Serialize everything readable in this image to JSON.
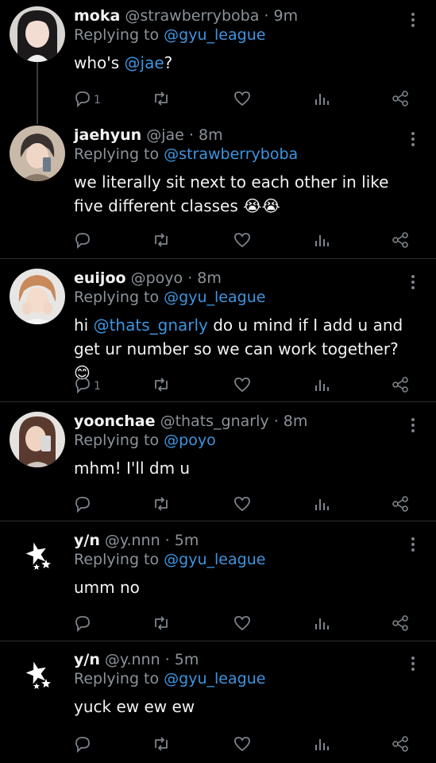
{
  "tweets": [
    {
      "name": "moka",
      "handle": "@strawberryboba",
      "time": "· 9m",
      "replying_label": "Replying to",
      "replying_to": "@gyu_league",
      "text_parts": [
        "who's ",
        "@jae",
        "?"
      ],
      "reply_count": "1"
    },
    {
      "name": "jaehyun",
      "handle": "@jae",
      "time": "· 8m",
      "replying_label": "Replying to",
      "replying_to": "@strawberryboba",
      "text": "we literally sit next to each other in like five different classes 😭😭",
      "reply_count": ""
    },
    {
      "name": "euijoo",
      "handle": "@poyo",
      "time": "· 8m",
      "replying_label": "Replying to",
      "replying_to": "@gyu_league",
      "text_parts": [
        "hi ",
        "@thats_gnarly",
        " do u mind if I add u and get ur number so we can work together? 😊"
      ],
      "reply_count": "1"
    },
    {
      "name": "yoonchae",
      "handle": "@thats_gnarly",
      "time": "· 8m",
      "replying_label": "Replying to",
      "replying_to": "@poyo",
      "text": "mhm! I'll dm u",
      "reply_count": ""
    },
    {
      "name": "y/n",
      "handle": "@y.nnn",
      "time": "· 5m",
      "replying_label": "Replying to",
      "replying_to": "@gyu_league",
      "text": "umm no",
      "reply_count": ""
    },
    {
      "name": "y/n",
      "handle": "@y.nnn",
      "time": "· 5m",
      "replying_label": "Replying to",
      "replying_to": "@gyu_league",
      "text": "yuck ew ew ew",
      "reply_count": ""
    }
  ],
  "icons": {
    "reply": "reply-icon",
    "retweet": "retweet-icon",
    "like": "heart-icon",
    "views": "analytics-icon",
    "share": "share-icon",
    "more": "more-vertical-icon"
  },
  "colors": {
    "background": "#000000",
    "text": "#f2f2f2",
    "muted": "#8b9299",
    "link": "#3d95e0",
    "icon": "#7c838a"
  }
}
